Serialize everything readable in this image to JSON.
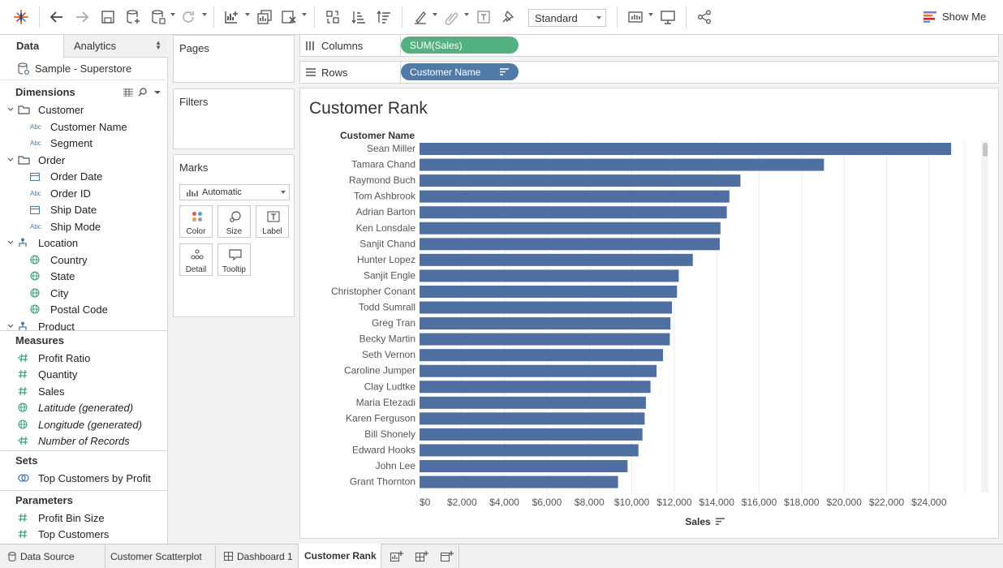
{
  "toolbar": {
    "fit_label": "Standard",
    "show_me_label": "Show Me",
    "icons": [
      "tableau-logo",
      "undo",
      "redo",
      "save",
      "new-datasource",
      "pause-updates",
      "refresh",
      "new-worksheet",
      "duplicate-sheet",
      "clear-sheet",
      "swap",
      "sort-ascending",
      "sort-descending",
      "highlight",
      "group",
      "label",
      "fix-axes",
      "fit",
      "presentation-mode",
      "share"
    ]
  },
  "data_pane": {
    "tabs": {
      "data": "Data",
      "analytics": "Analytics"
    },
    "datasource": "Sample - Superstore",
    "dimensions_title": "Dimensions",
    "dimensions": [
      {
        "type": "folder",
        "label": "Customer"
      },
      {
        "type": "string",
        "label": "Customer Name"
      },
      {
        "type": "string",
        "label": "Segment"
      },
      {
        "type": "folder",
        "label": "Order"
      },
      {
        "type": "date",
        "label": "Order Date"
      },
      {
        "type": "string",
        "label": "Order ID"
      },
      {
        "type": "date",
        "label": "Ship Date"
      },
      {
        "type": "string",
        "label": "Ship Mode"
      },
      {
        "type": "hierarchy",
        "label": "Location"
      },
      {
        "type": "geo",
        "label": "Country"
      },
      {
        "type": "geo",
        "label": "State"
      },
      {
        "type": "geo",
        "label": "City"
      },
      {
        "type": "geo",
        "label": "Postal Code"
      },
      {
        "type": "hierarchy",
        "label": "Product"
      }
    ],
    "abc_glyph": "Abc",
    "measures_title": "Measures",
    "measures": [
      {
        "label": "Profit Ratio",
        "type": "calc",
        "italic": false
      },
      {
        "label": "Quantity",
        "type": "number",
        "italic": false
      },
      {
        "label": "Sales",
        "type": "number",
        "italic": false
      },
      {
        "label": "Latitude (generated)",
        "type": "geo",
        "italic": true
      },
      {
        "label": "Longitude (generated)",
        "type": "geo",
        "italic": true
      },
      {
        "label": "Number of Records",
        "type": "calc",
        "italic": true
      }
    ],
    "sets_title": "Sets",
    "sets": [
      "Top Customers by Profit"
    ],
    "parameters_title": "Parameters",
    "parameters": [
      "Profit Bin Size",
      "Top Customers"
    ]
  },
  "cards": {
    "pages": "Pages",
    "filters": "Filters",
    "marks": "Marks",
    "mark_type": "Automatic",
    "mark_buttons": [
      "Color",
      "Size",
      "Label",
      "Detail",
      "Tooltip"
    ]
  },
  "shelves": {
    "columns_label": "Columns",
    "columns_pill": "SUM(Sales)",
    "rows_label": "Rows",
    "rows_pill": "Customer Name"
  },
  "viz": {
    "title": "Customer Rank"
  },
  "chart_data": {
    "type": "bar",
    "orientation": "horizontal",
    "title": "Customer Rank",
    "row_header": "Customer Name",
    "xlabel": "Sales",
    "xlim": [
      0,
      25500
    ],
    "xticks": [
      0,
      2000,
      4000,
      6000,
      8000,
      10000,
      12000,
      14000,
      16000,
      18000,
      20000,
      22000,
      24000
    ],
    "xtick_labels": [
      "$0",
      "$2,000",
      "$4,000",
      "$6,000",
      "$8,000",
      "$10,000",
      "$12,000",
      "$14,000",
      "$16,000",
      "$18,000",
      "$20,000",
      "$22,000",
      "$24,000"
    ],
    "grid": true,
    "bar_color": "#4f6fa0",
    "categories": [
      "Sean Miller",
      "Tamara Chand",
      "Raymond Buch",
      "Tom Ashbrook",
      "Adrian Barton",
      "Ken Lonsdale",
      "Sanjit Chand",
      "Hunter Lopez",
      "Sanjit Engle",
      "Christopher Conant",
      "Todd Sumrall",
      "Greg Tran",
      "Becky Martin",
      "Seth Vernon",
      "Caroline Jumper",
      "Clay Ludtke",
      "Maria Etezadi",
      "Karen Ferguson",
      "Bill Shonely",
      "Edward Hooks",
      "John Lee",
      "Grant Thornton"
    ],
    "values": [
      25043,
      19052,
      15117,
      14596,
      14474,
      14175,
      14142,
      12873,
      12209,
      12129,
      11891,
      11820,
      11790,
      11470,
      11165,
      10880,
      10663,
      10604,
      10501,
      10311,
      9800,
      9351
    ]
  },
  "sheet_tabs": {
    "datasource": "Data Source",
    "sheets": [
      "Customer Scatterplot",
      "Dashboard 1",
      "Customer Rank"
    ],
    "active": "Customer Rank"
  }
}
